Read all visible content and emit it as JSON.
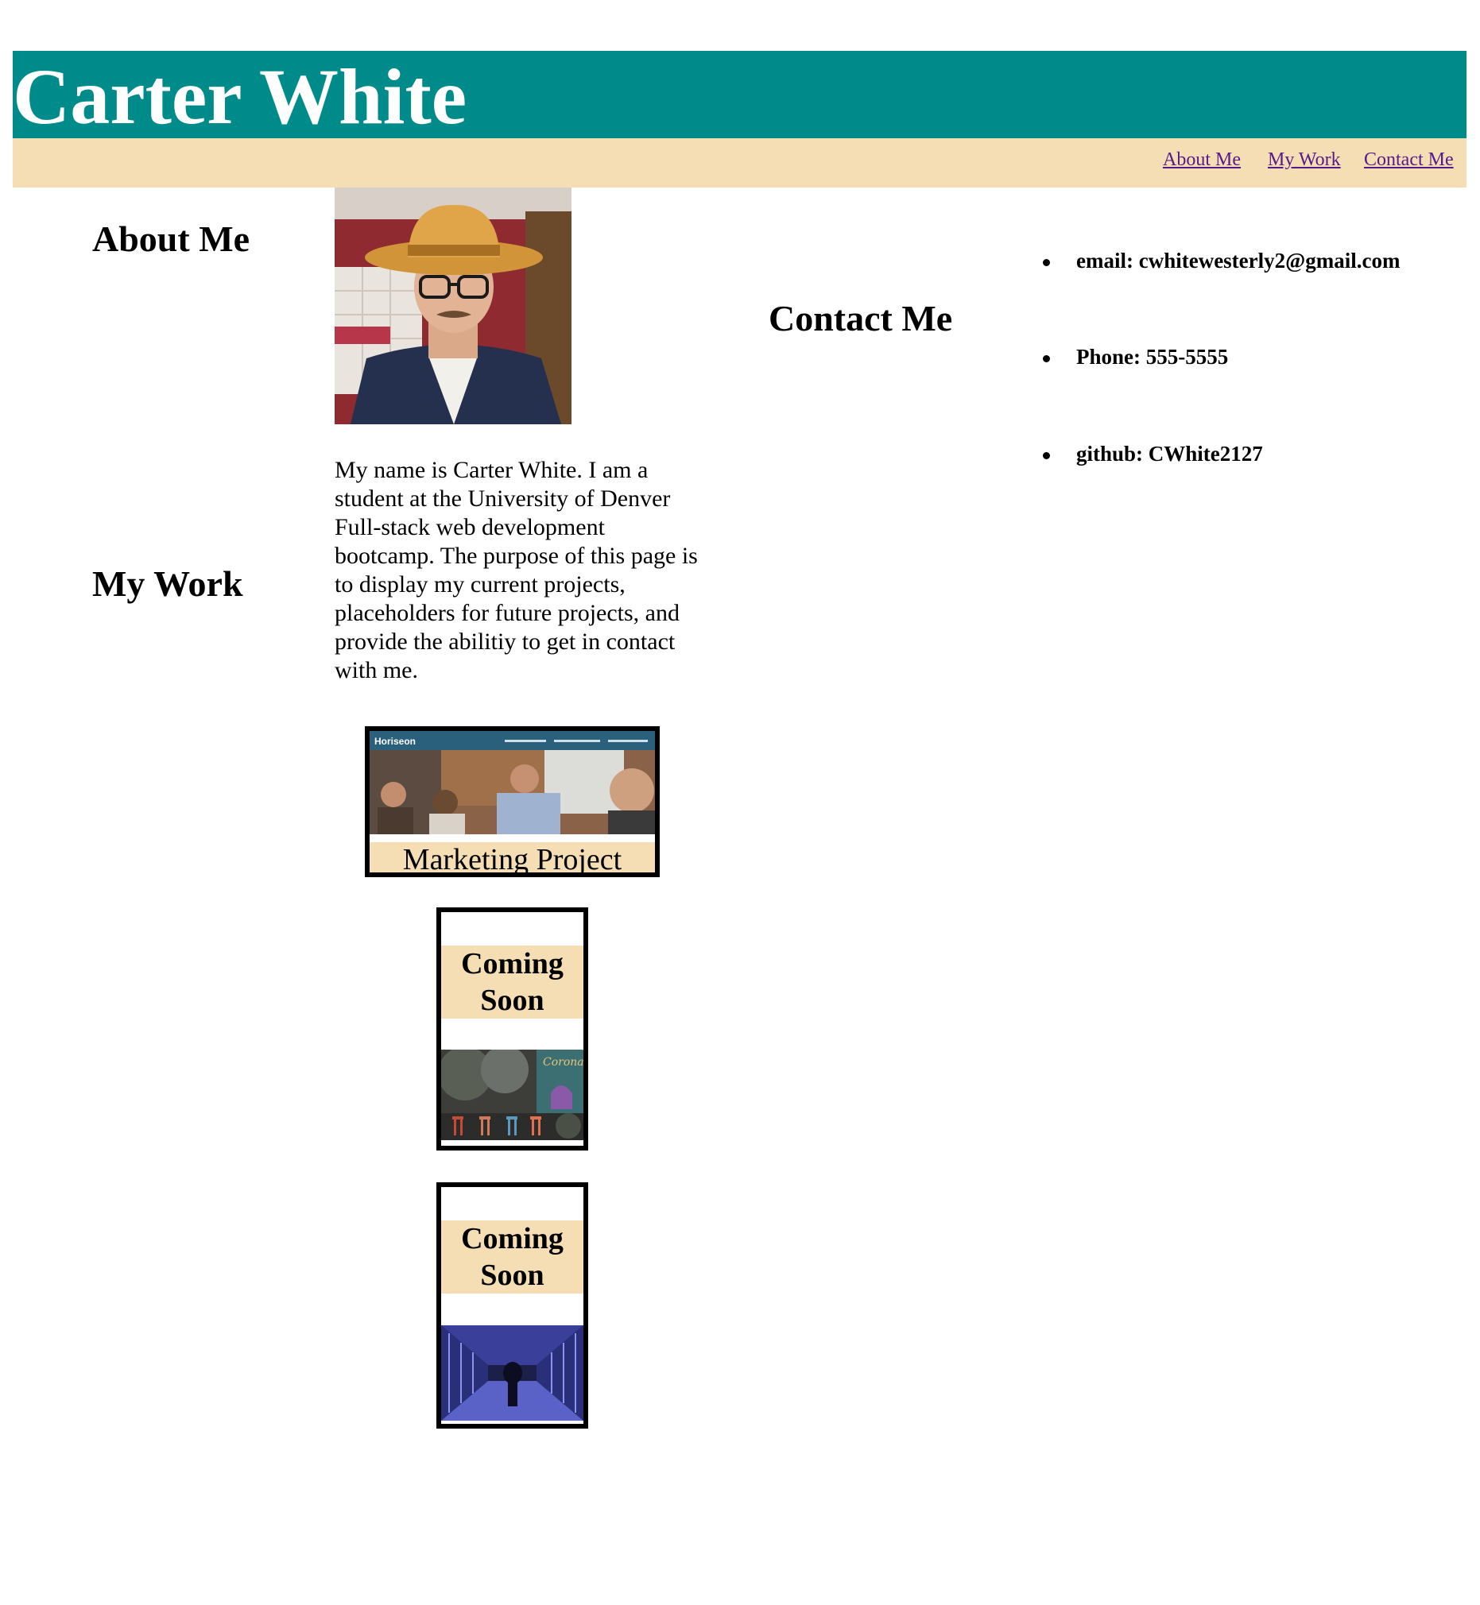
{
  "header": {
    "title": "Carter White"
  },
  "nav": {
    "items": [
      {
        "label": "About Me"
      },
      {
        "label": "My Work"
      },
      {
        "label": "Contact Me"
      }
    ]
  },
  "about": {
    "heading": "About Me",
    "bio": "My name is Carter White. I am a student at the University of Denver Full-stack web development bootcamp. The purpose of this page is to display my current projects, placeholders for future projects, and provide the abilitiy to get in contact with me."
  },
  "work": {
    "heading": "My Work",
    "projects": [
      {
        "label": "Marketing Project",
        "thumb_brand": "Horiseon"
      },
      {
        "label": "Coming Soon"
      },
      {
        "label": "Coming Soon"
      }
    ]
  },
  "contact": {
    "heading": "Contact Me",
    "items": [
      {
        "text": "email: cwhitewesterly2@gmail.com"
      },
      {
        "text": "Phone: 555-5555"
      },
      {
        "text": "github: CWhite2127"
      }
    ]
  },
  "colors": {
    "header_bg": "#008b8b",
    "nav_bg": "#f5deb3",
    "link": "#551a8b"
  }
}
